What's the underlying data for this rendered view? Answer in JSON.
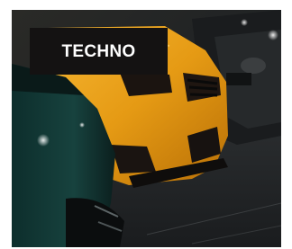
{
  "card": {
    "category_label": "TECHNO",
    "image_icon": "sports-cars-parking-photo",
    "colors": {
      "badge_background": "#141212",
      "badge_text": "#ffffff",
      "car_accent": "#f0a318"
    }
  }
}
